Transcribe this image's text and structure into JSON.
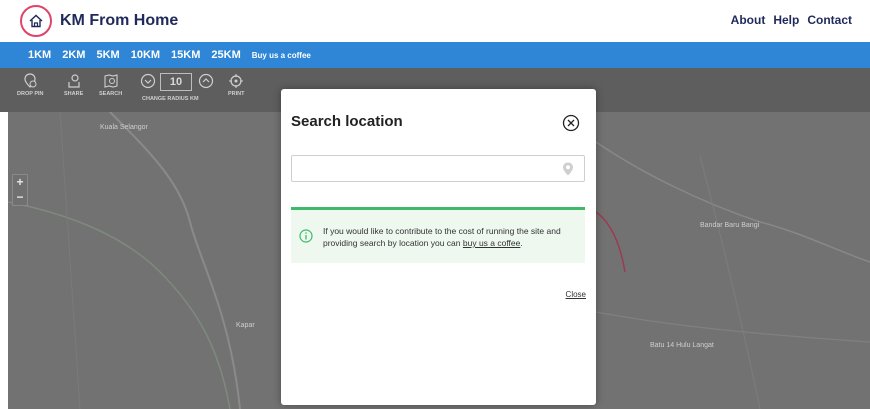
{
  "header": {
    "brand": "KM From Home",
    "nav": [
      "About",
      "Help",
      "Contact"
    ]
  },
  "bluebar": {
    "items": [
      "1KM",
      "2KM",
      "5KM",
      "10KM",
      "15KM",
      "25KM"
    ],
    "coffee": "Buy us a coffee"
  },
  "toolbar": {
    "drop_pin": "DROP PIN",
    "share": "SHARE",
    "search": "SEARCH",
    "change_radius": "CHANGE RADIUS KM",
    "radius_value": "10",
    "print": "PRINT"
  },
  "map": {
    "zoom_in": "+",
    "zoom_out": "−",
    "labels": [
      "Kuala Selangor",
      "Kapar",
      "Batu 14 Hulu Langat",
      "Bandar Baru Bangi"
    ]
  },
  "modal": {
    "title": "Search location",
    "search_placeholder": "",
    "info_text_before": "If you would like to contribute to the cost of running the site and providing search by location you can ",
    "info_link": "buy us a coffee",
    "info_text_after": ".",
    "close_label": "Close"
  },
  "colors": {
    "brand_blue": "#2f86d6",
    "accent_pink": "#e0436a",
    "success_green": "#3dbb6b",
    "navy": "#1f2a5a"
  }
}
